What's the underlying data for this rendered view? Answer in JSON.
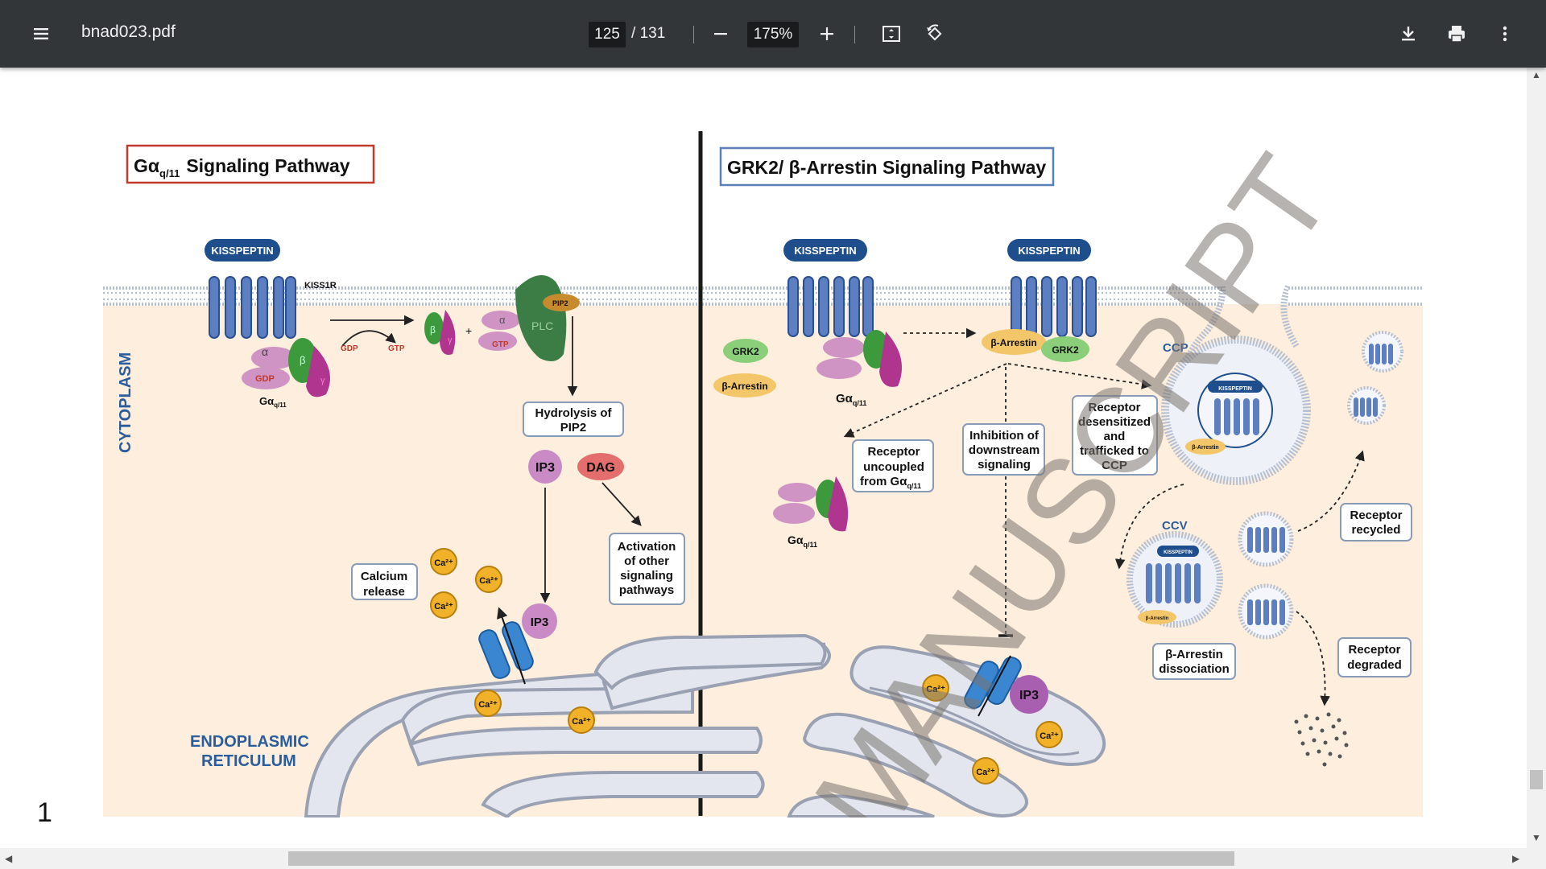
{
  "viewer": {
    "file_name": "bnad023.pdf",
    "current_page": "125",
    "page_separator": "/",
    "total_pages": "131",
    "zoom": "175%",
    "icons": [
      "menu-icon",
      "zoom-out-icon",
      "zoom-in-icon",
      "fit-page-icon",
      "rotate-icon",
      "download-icon",
      "print-icon",
      "more-vert-icon"
    ]
  },
  "figure": {
    "left_title_prefix": "Gα",
    "left_title_sub": "q/11",
    "left_title_rest": "Signaling Pathway",
    "right_title": "GRK2/ β-Arrestin Signaling Pathway",
    "kisspeptin": "KISSPEPTIN",
    "kiss1r": "KISS1R",
    "cytoplasm": "CYTOPLASM",
    "er_line1": "ENDOPLASMIC",
    "er_line2": "RETICULUM",
    "gdp": "GDP",
    "gtp": "GTP",
    "alpha": "α",
    "beta": "β",
    "gamma": "γ",
    "plus": "+",
    "plc": "PLC",
    "pip2": "PIP2",
    "gaq_prefix": "Gα",
    "gaq_sub": "q/11",
    "hydrolysis_1": "Hydrolysis of",
    "hydrolysis_2": "PIP2",
    "ip3": "IP3",
    "dag": "DAG",
    "activation_1": "Activation",
    "activation_2": "of other",
    "activation_3": "signaling",
    "activation_4": "pathways",
    "calcium_1": "Calcium",
    "calcium_2": "release",
    "ca": "Ca²⁺",
    "grk2": "GRK2",
    "b_arrestin": "β-Arrestin",
    "ccp": "CCP",
    "ccv": "CCV",
    "uncoupled_1": "Receptor",
    "uncoupled_2": "uncoupled",
    "uncoupled_3": "from Gα",
    "uncoupled_sub": "q/11",
    "inhibition_1": "Inhibition of",
    "inhibition_2": "downstream",
    "inhibition_3": "signaling",
    "desens_1": "Receptor",
    "desens_2": "desensitized",
    "desens_3": "and",
    "desens_4": "trafficked to",
    "desens_5": "CCP",
    "recycled_1": "Receptor",
    "recycled_2": "recycled",
    "degraded_1": "Receptor",
    "degraded_2": "degraded",
    "dissoc_1": "β-Arrestin",
    "dissoc_2": "dissociation",
    "watermark": "MANUSCRIPT",
    "page_label": "1"
  }
}
